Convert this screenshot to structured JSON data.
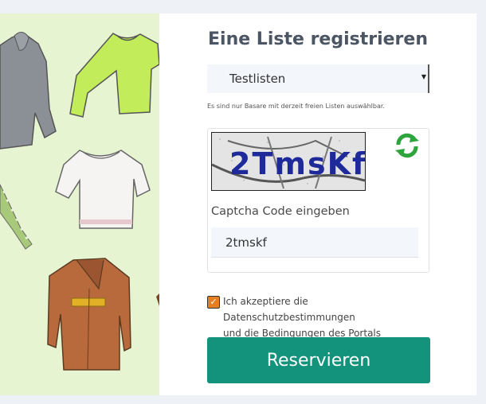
{
  "form": {
    "title": "Eine Liste registrieren",
    "list_select": {
      "selected": "Testlisten"
    },
    "hint": "Es sind nur Basare mit derzeit freien Listen auswählbar.",
    "captcha": {
      "image_text": "2TmsKf",
      "label": "Captcha Code eingeben",
      "input_value": "2tmskf"
    },
    "consent": {
      "checked": true,
      "line1": "Ich akzeptiere die Datenschutzbestimmungen",
      "line2": "und die Bedingungen des Portals"
    },
    "submit_label": "Reservieren"
  },
  "icons": {
    "refresh": "refresh-icon",
    "select_arrow": "caret-down-icon",
    "checkbox": "checkmark-icon"
  },
  "colors": {
    "accent": "#13937b",
    "checkbox": "#e67e22",
    "illustration_bg": "#e6f4d2"
  }
}
